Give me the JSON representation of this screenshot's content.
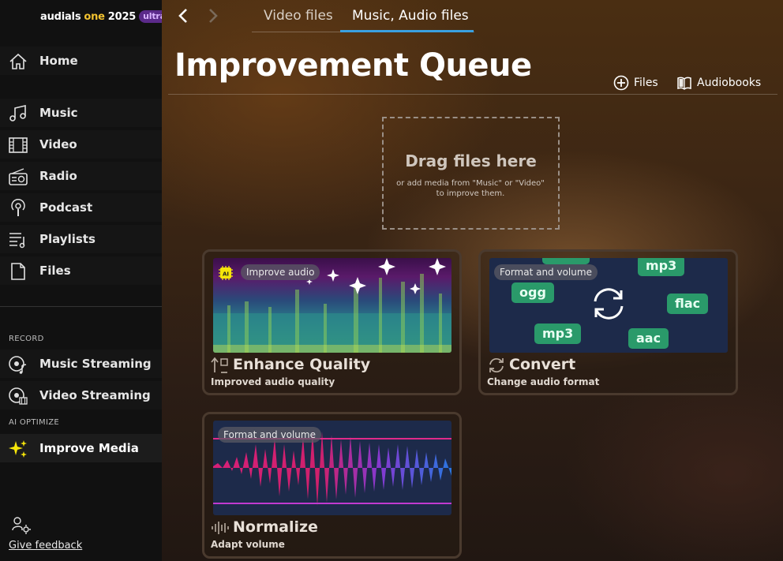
{
  "brand": {
    "part1": "audials",
    "part2": "one",
    "part3": "2025",
    "badge": "ultra"
  },
  "sidebar": {
    "items": [
      {
        "label": "Home",
        "icon": "home-icon"
      },
      {
        "label": "Music",
        "icon": "music-note-icon"
      },
      {
        "label": "Video",
        "icon": "film-icon"
      },
      {
        "label": "Radio",
        "icon": "radio-icon"
      },
      {
        "label": "Podcast",
        "icon": "podcast-icon"
      },
      {
        "label": "Playlists",
        "icon": "playlist-icon"
      },
      {
        "label": "Files",
        "icon": "file-icon"
      }
    ],
    "record_label": "RECORD",
    "record_items": [
      {
        "label": "Music Streaming",
        "icon": "music-stream-icon"
      },
      {
        "label": "Video Streaming",
        "icon": "video-stream-icon"
      }
    ],
    "ai_label": "AI OPTIMIZE",
    "ai_items": [
      {
        "label": "Improve Media",
        "icon": "sparkle-icon"
      }
    ],
    "feedback": "Give feedback"
  },
  "tabs": [
    {
      "label": "Video files"
    },
    {
      "label": "Music, Audio files"
    }
  ],
  "page": {
    "title": "Improvement Queue"
  },
  "actions": {
    "files": "Files",
    "audiobooks": "Audiobooks"
  },
  "dropzone": {
    "title": "Drag files here",
    "subtitle": "or add media from \"Music\" or \"Video\" to improve them."
  },
  "cards": [
    {
      "chip": "Improve audio",
      "badge": "AI",
      "title": "Enhance Quality",
      "subtitle": "Improved audio quality"
    },
    {
      "chip": "Format and volume",
      "title": "Convert",
      "subtitle": "Change audio format",
      "formats": [
        "mp3",
        "ogg",
        "flac",
        "mp3",
        "aac"
      ]
    },
    {
      "chip": "Format and volume",
      "title": "Normalize",
      "subtitle": "Adapt volume"
    }
  ],
  "colors": {
    "accent": "#3aa0e0",
    "brand_yellow": "#f2c230",
    "format_green": "#2a9a6a",
    "ai_yellow": "#f5e50a"
  }
}
